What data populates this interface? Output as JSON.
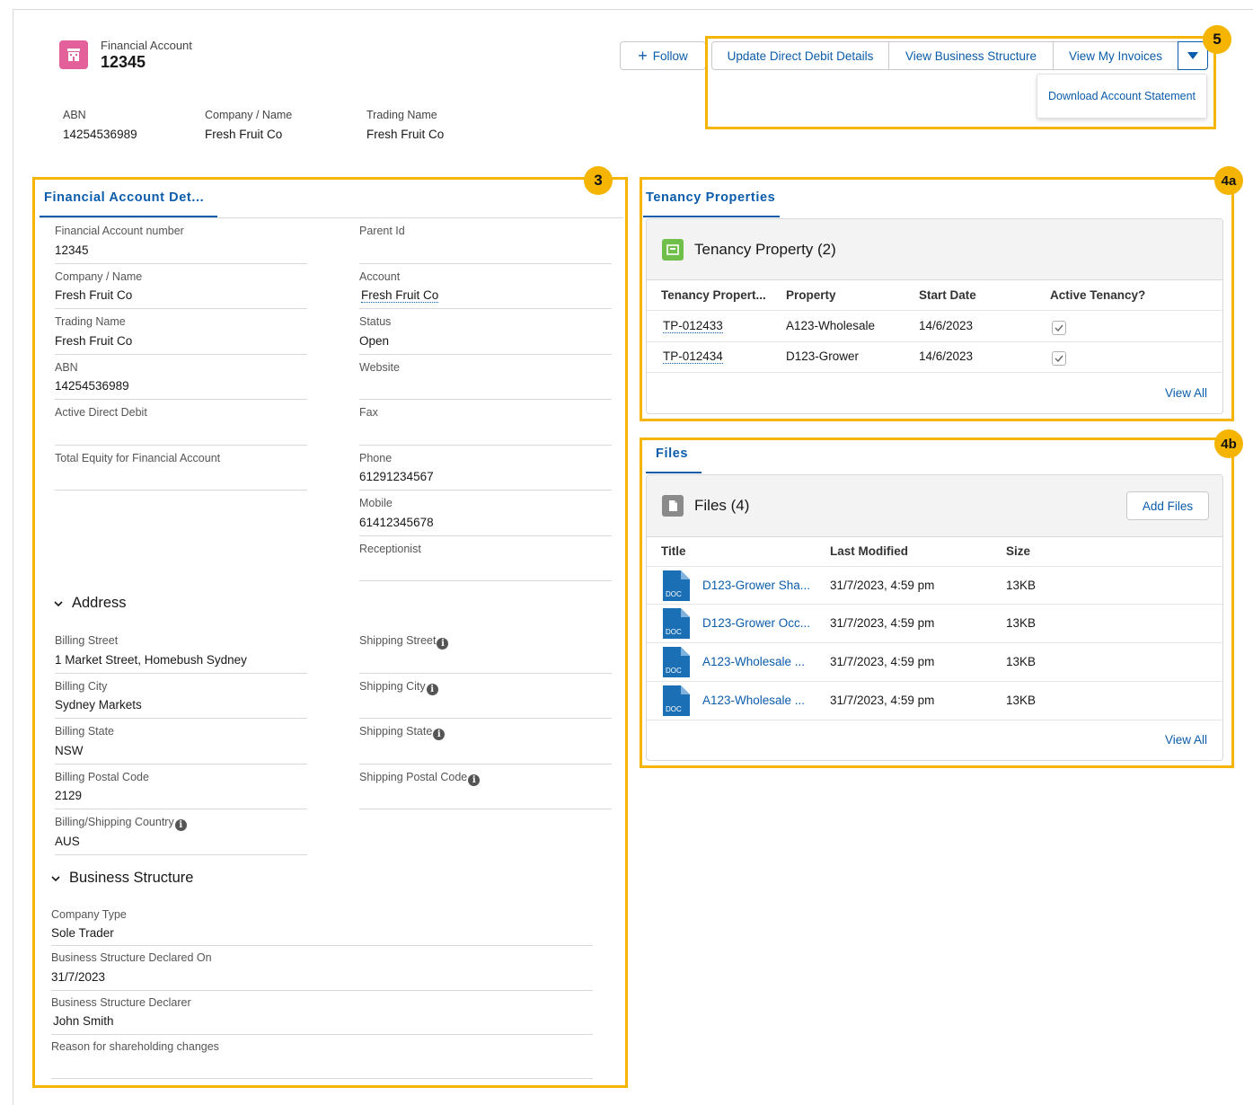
{
  "header": {
    "object_label": "Financial Account",
    "record_title": "12345",
    "fields": [
      {
        "label": "ABN",
        "value": "14254536989"
      },
      {
        "label": "Company / Name",
        "value": "Fresh Fruit Co"
      },
      {
        "label": "Trading Name",
        "value": "Fresh Fruit Co"
      }
    ]
  },
  "actions": {
    "follow": "Follow",
    "buttons": [
      "Update Direct Debit Details",
      "View Business Structure",
      "View My Invoices"
    ],
    "menu_items": [
      "Download Account Statement"
    ]
  },
  "callouts": {
    "actions": "5",
    "details": "3",
    "tenancy": "4a",
    "files": "4b"
  },
  "details": {
    "tab": "Financial Account Det...",
    "left_fields": [
      {
        "label": "Financial Account number",
        "value": "12345"
      },
      {
        "label": "Company / Name",
        "value": "Fresh Fruit Co"
      },
      {
        "label": "Trading Name",
        "value": "Fresh Fruit Co"
      },
      {
        "label": "ABN",
        "value": "14254536989"
      },
      {
        "label": "Active Direct Debit",
        "value": ""
      },
      {
        "label": "Total Equity for Financial Account",
        "value": ""
      }
    ],
    "right_fields": [
      {
        "label": "Parent Id",
        "value": ""
      },
      {
        "label": "Account",
        "value": "Fresh Fruit Co"
      },
      {
        "label": "Status",
        "value": "Open"
      },
      {
        "label": "Website",
        "value": ""
      },
      {
        "label": "Fax",
        "value": ""
      },
      {
        "label": "Phone",
        "value": "61291234567"
      },
      {
        "label": "Mobile",
        "value": "61412345678"
      },
      {
        "label": "Receptionist",
        "value": ""
      }
    ],
    "address": {
      "title": "Address",
      "left_fields": [
        {
          "label": "Billing Street",
          "value": "1 Market Street, Homebush Sydney"
        },
        {
          "label": "Billing City",
          "value": "Sydney Markets"
        },
        {
          "label": "Billing State",
          "value": "NSW"
        },
        {
          "label": "Billing Postal Code",
          "value": "2129"
        },
        {
          "label": "Billing/Shipping Country",
          "value": "AUS"
        }
      ],
      "right_fields": [
        {
          "label": "Shipping Street",
          "value": ""
        },
        {
          "label": "Shipping City",
          "value": ""
        },
        {
          "label": "Shipping State",
          "value": ""
        },
        {
          "label": "Shipping Postal Code",
          "value": ""
        }
      ]
    },
    "business": {
      "title": "Business Structure",
      "fields": [
        {
          "label": "Company Type",
          "value": "Sole Trader"
        },
        {
          "label": "Business Structure Declared On",
          "value": "31/7/2023"
        },
        {
          "label": "Business Structure Declarer",
          "value": "John Smith"
        },
        {
          "label": "Reason for shareholding changes",
          "value": ""
        }
      ]
    }
  },
  "tenancy": {
    "tab": "Tenancy Properties",
    "card_title": "Tenancy Property (2)",
    "columns": [
      "Tenancy Propert...",
      "Property",
      "Start Date",
      "Active Tenancy?"
    ],
    "rows": [
      {
        "id": "TP-012433",
        "property": "A123-Wholesale",
        "start": "14/6/2023",
        "active": true
      },
      {
        "id": "TP-012434",
        "property": "D123-Grower",
        "start": "14/6/2023",
        "active": true
      }
    ],
    "view_all": "View All"
  },
  "files": {
    "tab": "Files",
    "card_title": "Files (4)",
    "add_button": "Add Files",
    "columns": [
      "Title",
      "Last Modified",
      "Size"
    ],
    "rows": [
      {
        "title": "D123-Grower Sha...",
        "modified": "31/7/2023, 4:59 pm",
        "size": "13KB"
      },
      {
        "title": "D123-Grower Occ...",
        "modified": "31/7/2023, 4:59 pm",
        "size": "13KB"
      },
      {
        "title": "A123-Wholesale ...",
        "modified": "31/7/2023, 4:59 pm",
        "size": "13KB"
      },
      {
        "title": "A123-Wholesale ...",
        "modified": "31/7/2023, 4:59 pm",
        "size": "13KB"
      }
    ],
    "doc_label": "DOC",
    "view_all": "View All"
  }
}
